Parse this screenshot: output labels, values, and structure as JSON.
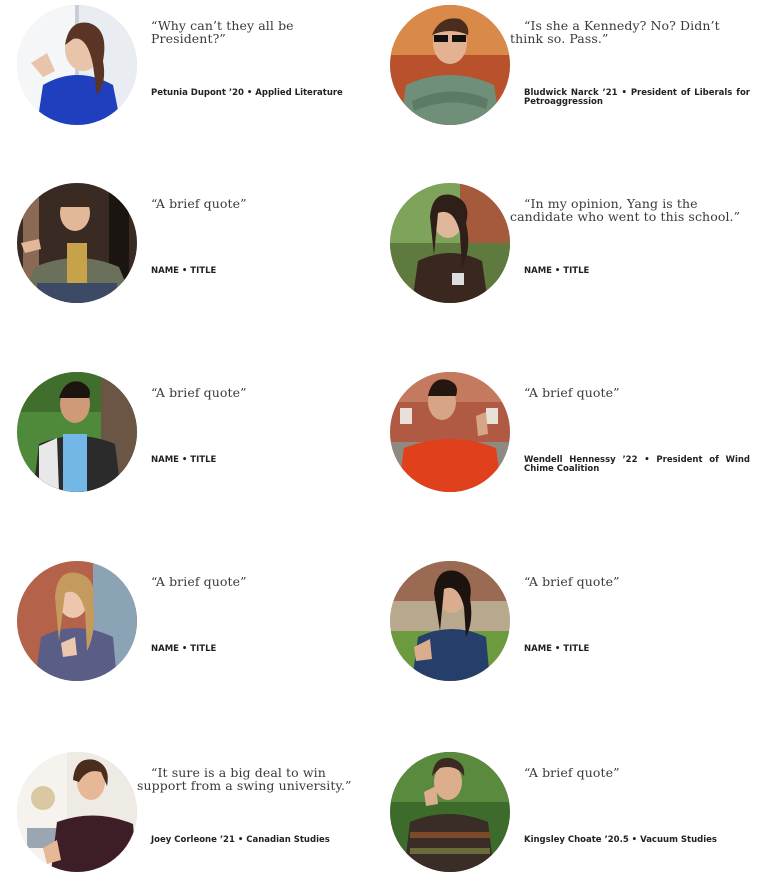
{
  "testimonials": [
    {
      "quote": "“Why can’t they all be President?”",
      "name_title": "Petunia Dupont ’20 • Applied Literature"
    },
    {
      "quote": "“Is she a Kennedy? No? Didn’t think so. Pass.”",
      "name_title": "Bludwick Narck ’21 • President of Liberals for Petroaggression"
    },
    {
      "quote": "“A brief quote”",
      "name_title": "NAME • TITLE"
    },
    {
      "quote": "“In my opinion, Yang is the candidate who went to this school.”",
      "name_title": "NAME • TITLE"
    },
    {
      "quote": "“A brief quote”",
      "name_title": "NAME • TITLE"
    },
    {
      "quote": "“A brief quote”",
      "name_title": "Wendell Hennessy ’22 • President of Wind Chime Coalition"
    },
    {
      "quote": "“A brief quote”",
      "name_title": "NAME • TITLE"
    },
    {
      "quote": "“A brief quote”",
      "name_title": "NAME • TITLE"
    },
    {
      "quote": "“It sure is a big deal to win support from a swing university.”",
      "name_title": "Joey Corleone ’21 • Canadian Studies"
    },
    {
      "quote": "“A brief quote”",
      "name_title": "Kingsley Choate ’20.5 • Vacuum Studies"
    }
  ]
}
